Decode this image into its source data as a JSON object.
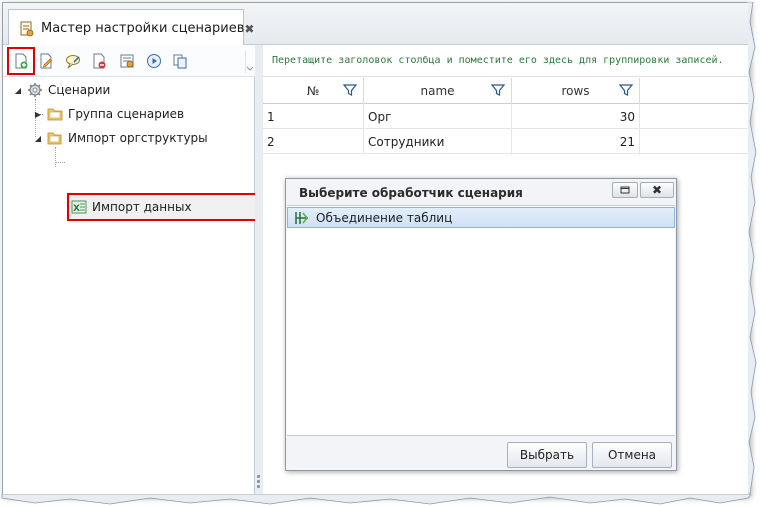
{
  "window": {
    "tab_title": "Мастер настройки сценариев",
    "tab_close": "✖"
  },
  "toolbar": {
    "buttons": [
      "add-icon",
      "edit-icon",
      "comment-icon",
      "delete-icon",
      "settings-icon",
      "run-icon",
      "copy-icon"
    ],
    "highlight_color": "#e00000"
  },
  "tree": {
    "root": "Сценарии",
    "items": [
      {
        "label": "Группа сценариев",
        "expander": "▶"
      },
      {
        "label": "Импорт оргструктуры",
        "expander": "◢"
      },
      {
        "label": "Импорт данных"
      }
    ],
    "root_expander": "◢"
  },
  "grid": {
    "group_hint": "Перетащите заголовок столбца и поместите его здесь для группировки записей.",
    "columns": [
      "№",
      "name",
      "rows"
    ],
    "rows": [
      {
        "num": "1",
        "name": "Орг",
        "rows": "30"
      },
      {
        "num": "2",
        "name": "Сотрудники",
        "rows": "21"
      }
    ]
  },
  "dialog": {
    "title": "Выберите обработчик сценария",
    "close": "✖",
    "items": [
      {
        "label": "Объединение таблиц"
      }
    ],
    "ok_label": "Выбрать",
    "cancel_label": "Отмена"
  },
  "colors": {
    "hint_green": "#2a7a3a",
    "selection_blue": "#cfe0f5",
    "frame": "#e9edf3"
  }
}
